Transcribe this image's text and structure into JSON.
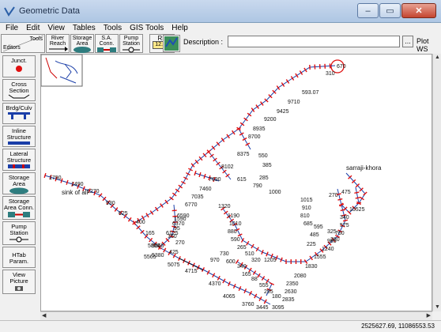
{
  "window": {
    "title": "Geometric Data",
    "min": "–",
    "max": "▭",
    "close": "✕"
  },
  "menu": [
    "File",
    "Edit",
    "View",
    "Tables",
    "Tools",
    "GIS Tools",
    "Help"
  ],
  "toolbar": {
    "tools_label_top": "Tools",
    "tools_label_bottom": "Editors",
    "river_reach": "River Reach",
    "storage_area": "Storage Area",
    "sa_conn": "S.A. Conn.",
    "pump_station": "Pump Station",
    "rs": "RS",
    "rs_value": "12.99",
    "description_label": "Description :",
    "description_value": "",
    "browse": "...",
    "plot_ws": "Plot WS"
  },
  "tools": [
    {
      "label": "Junct."
    },
    {
      "label": "Cross Section"
    },
    {
      "label": "Brdg/Culv"
    },
    {
      "label": "Inline Structure"
    },
    {
      "label": "Lateral Structure"
    },
    {
      "label": "Storage Area"
    },
    {
      "label": "Storage Area Conn."
    },
    {
      "label": "Pump Station"
    },
    {
      "label": "HTab Param."
    },
    {
      "label": "View Picture"
    }
  ],
  "map": {
    "reach_labels": {
      "sink": "sink of all",
      "sarraji": "sarraji-khora"
    },
    "nodes": [
      "1790",
      "1490",
      "1270",
      "930",
      "625",
      "400",
      "165",
      "5665",
      "5380",
      "5075",
      "4715",
      "4370",
      "4065",
      "3760",
      "3445",
      "3095",
      "2835",
      "2630",
      "2350",
      "2080",
      "1830",
      "1555",
      "1240",
      "985",
      "760",
      "575",
      "340",
      "10525",
      "270",
      "475",
      "1015",
      "910",
      "810",
      "685",
      "595",
      "485",
      "325",
      "280",
      "225",
      "5800",
      "5565",
      "6125",
      "6370",
      "6590",
      "6770",
      "7035",
      "7460",
      "7690",
      "8102",
      "8375",
      "8700",
      "8935",
      "9200",
      "9425",
      "9710",
      "593.07",
      "310",
      "670",
      "550",
      "385",
      "285",
      "790",
      "1000",
      "615",
      "425",
      "270",
      "160",
      "95",
      "1590",
      "1320",
      "1190",
      "1010",
      "880",
      "590",
      "265",
      "510",
      "320",
      "1205",
      "970",
      "730",
      "600",
      "340",
      "165",
      "88",
      "555",
      "295",
      "180"
    ]
  },
  "status": {
    "coordinates": "2525627.69, 11086553.53"
  }
}
